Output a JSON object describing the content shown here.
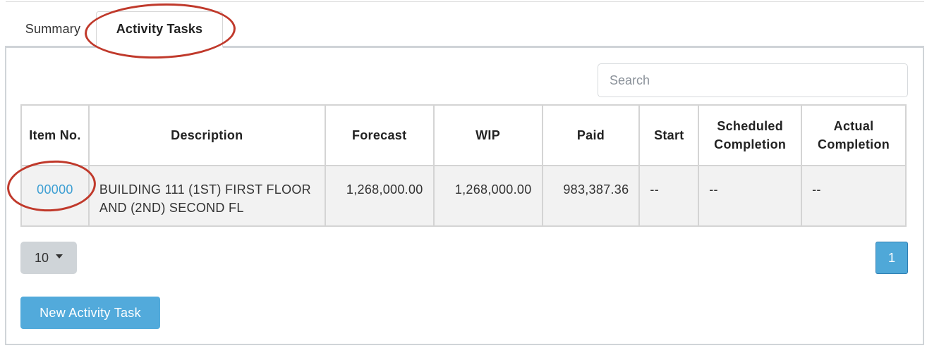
{
  "tabs": [
    {
      "label": "Summary"
    },
    {
      "label": "Activity Tasks",
      "active": true
    }
  ],
  "search": {
    "placeholder": "Search",
    "value": ""
  },
  "table": {
    "columns": [
      "Item No.",
      "Description",
      "Forecast",
      "WIP",
      "Paid",
      "Start",
      "Scheduled Completion",
      "Actual Completion"
    ],
    "rows": [
      {
        "item_no": "00000",
        "description": "BUILDING 111 (1ST) FIRST FLOOR AND (2ND) SECOND FL",
        "forecast": "1,268,000.00",
        "wip": "1,268,000.00",
        "paid": "983,387.36",
        "start": "--",
        "scheduled_completion": "--",
        "actual_completion": "--"
      }
    ]
  },
  "pagination": {
    "page_size": "10",
    "current_page": "1"
  },
  "actions": {
    "new_task_label": "New Activity Task"
  },
  "colors": {
    "link": "#3d9fd3",
    "primary_button": "#52aadb",
    "annotation": "#c0392b",
    "row_background": "#f2f2f2"
  },
  "icons": {
    "page_size_caret": "caret-down-icon"
  }
}
